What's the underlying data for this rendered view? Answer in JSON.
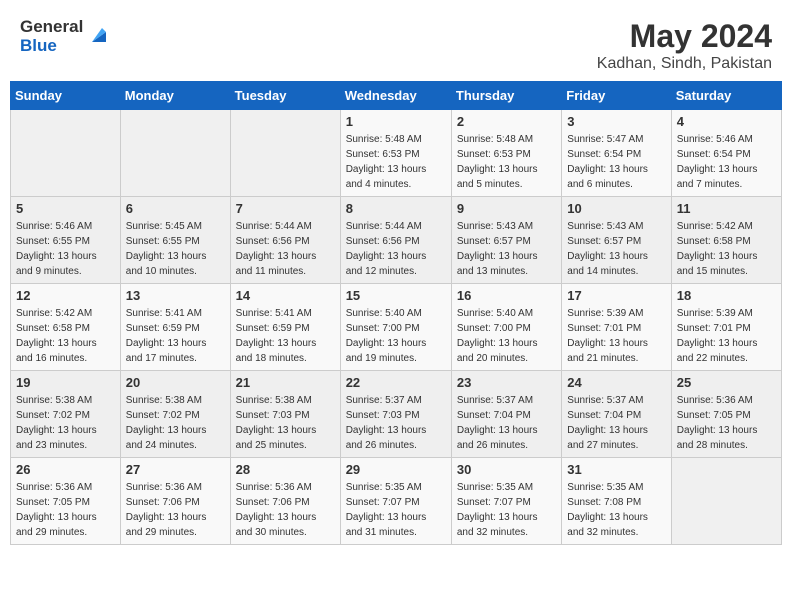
{
  "header": {
    "logo_general": "General",
    "logo_blue": "Blue",
    "title": "May 2024",
    "location": "Kadhan, Sindh, Pakistan"
  },
  "weekdays": [
    "Sunday",
    "Monday",
    "Tuesday",
    "Wednesday",
    "Thursday",
    "Friday",
    "Saturday"
  ],
  "weeks": [
    [
      {
        "day": "",
        "info": ""
      },
      {
        "day": "",
        "info": ""
      },
      {
        "day": "",
        "info": ""
      },
      {
        "day": "1",
        "info": "Sunrise: 5:48 AM\nSunset: 6:53 PM\nDaylight: 13 hours\nand 4 minutes."
      },
      {
        "day": "2",
        "info": "Sunrise: 5:48 AM\nSunset: 6:53 PM\nDaylight: 13 hours\nand 5 minutes."
      },
      {
        "day": "3",
        "info": "Sunrise: 5:47 AM\nSunset: 6:54 PM\nDaylight: 13 hours\nand 6 minutes."
      },
      {
        "day": "4",
        "info": "Sunrise: 5:46 AM\nSunset: 6:54 PM\nDaylight: 13 hours\nand 7 minutes."
      }
    ],
    [
      {
        "day": "5",
        "info": "Sunrise: 5:46 AM\nSunset: 6:55 PM\nDaylight: 13 hours\nand 9 minutes."
      },
      {
        "day": "6",
        "info": "Sunrise: 5:45 AM\nSunset: 6:55 PM\nDaylight: 13 hours\nand 10 minutes."
      },
      {
        "day": "7",
        "info": "Sunrise: 5:44 AM\nSunset: 6:56 PM\nDaylight: 13 hours\nand 11 minutes."
      },
      {
        "day": "8",
        "info": "Sunrise: 5:44 AM\nSunset: 6:56 PM\nDaylight: 13 hours\nand 12 minutes."
      },
      {
        "day": "9",
        "info": "Sunrise: 5:43 AM\nSunset: 6:57 PM\nDaylight: 13 hours\nand 13 minutes."
      },
      {
        "day": "10",
        "info": "Sunrise: 5:43 AM\nSunset: 6:57 PM\nDaylight: 13 hours\nand 14 minutes."
      },
      {
        "day": "11",
        "info": "Sunrise: 5:42 AM\nSunset: 6:58 PM\nDaylight: 13 hours\nand 15 minutes."
      }
    ],
    [
      {
        "day": "12",
        "info": "Sunrise: 5:42 AM\nSunset: 6:58 PM\nDaylight: 13 hours\nand 16 minutes."
      },
      {
        "day": "13",
        "info": "Sunrise: 5:41 AM\nSunset: 6:59 PM\nDaylight: 13 hours\nand 17 minutes."
      },
      {
        "day": "14",
        "info": "Sunrise: 5:41 AM\nSunset: 6:59 PM\nDaylight: 13 hours\nand 18 minutes."
      },
      {
        "day": "15",
        "info": "Sunrise: 5:40 AM\nSunset: 7:00 PM\nDaylight: 13 hours\nand 19 minutes."
      },
      {
        "day": "16",
        "info": "Sunrise: 5:40 AM\nSunset: 7:00 PM\nDaylight: 13 hours\nand 20 minutes."
      },
      {
        "day": "17",
        "info": "Sunrise: 5:39 AM\nSunset: 7:01 PM\nDaylight: 13 hours\nand 21 minutes."
      },
      {
        "day": "18",
        "info": "Sunrise: 5:39 AM\nSunset: 7:01 PM\nDaylight: 13 hours\nand 22 minutes."
      }
    ],
    [
      {
        "day": "19",
        "info": "Sunrise: 5:38 AM\nSunset: 7:02 PM\nDaylight: 13 hours\nand 23 minutes."
      },
      {
        "day": "20",
        "info": "Sunrise: 5:38 AM\nSunset: 7:02 PM\nDaylight: 13 hours\nand 24 minutes."
      },
      {
        "day": "21",
        "info": "Sunrise: 5:38 AM\nSunset: 7:03 PM\nDaylight: 13 hours\nand 25 minutes."
      },
      {
        "day": "22",
        "info": "Sunrise: 5:37 AM\nSunset: 7:03 PM\nDaylight: 13 hours\nand 26 minutes."
      },
      {
        "day": "23",
        "info": "Sunrise: 5:37 AM\nSunset: 7:04 PM\nDaylight: 13 hours\nand 26 minutes."
      },
      {
        "day": "24",
        "info": "Sunrise: 5:37 AM\nSunset: 7:04 PM\nDaylight: 13 hours\nand 27 minutes."
      },
      {
        "day": "25",
        "info": "Sunrise: 5:36 AM\nSunset: 7:05 PM\nDaylight: 13 hours\nand 28 minutes."
      }
    ],
    [
      {
        "day": "26",
        "info": "Sunrise: 5:36 AM\nSunset: 7:05 PM\nDaylight: 13 hours\nand 29 minutes."
      },
      {
        "day": "27",
        "info": "Sunrise: 5:36 AM\nSunset: 7:06 PM\nDaylight: 13 hours\nand 29 minutes."
      },
      {
        "day": "28",
        "info": "Sunrise: 5:36 AM\nSunset: 7:06 PM\nDaylight: 13 hours\nand 30 minutes."
      },
      {
        "day": "29",
        "info": "Sunrise: 5:35 AM\nSunset: 7:07 PM\nDaylight: 13 hours\nand 31 minutes."
      },
      {
        "day": "30",
        "info": "Sunrise: 5:35 AM\nSunset: 7:07 PM\nDaylight: 13 hours\nand 32 minutes."
      },
      {
        "day": "31",
        "info": "Sunrise: 5:35 AM\nSunset: 7:08 PM\nDaylight: 13 hours\nand 32 minutes."
      },
      {
        "day": "",
        "info": ""
      }
    ]
  ]
}
